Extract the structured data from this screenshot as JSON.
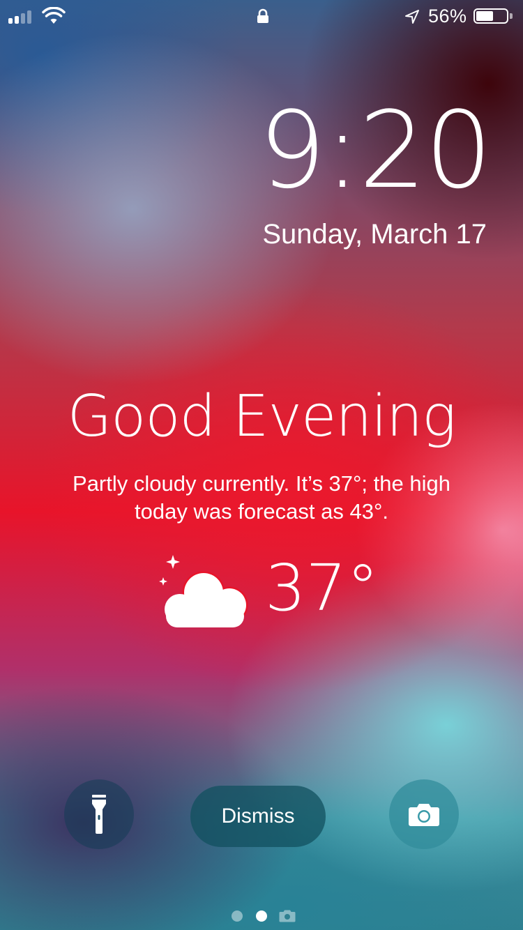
{
  "status_bar": {
    "signal_bars_active": 2,
    "signal_bars_total": 4,
    "battery_percent_label": "56%",
    "battery_level": 0.56,
    "icons": [
      "signal-icon",
      "wifi-icon",
      "lock-icon",
      "location-arrow-icon",
      "battery-icon"
    ]
  },
  "lock_screen": {
    "time": "9:20",
    "date": "Sunday, March 17"
  },
  "weather_card": {
    "greeting": "Good Evening",
    "forecast_line_1": "Partly cloudy currently. It’s 37°; the high",
    "forecast_line_2": "today was forecast as 43°.",
    "temperature": "37°",
    "icon": "partly-cloudy-night-icon"
  },
  "controls": {
    "flashlight_icon": "flashlight-icon",
    "dismiss_label": "Dismiss",
    "camera_icon": "camera-icon"
  },
  "page_indicator": {
    "pages": 3,
    "current": 2,
    "last_icon": "camera-icon"
  },
  "colors": {
    "text": "#ffffff",
    "flashlight_button": "#143c55",
    "dismiss_button": "#12505f",
    "camera_button": "#328c9b"
  }
}
